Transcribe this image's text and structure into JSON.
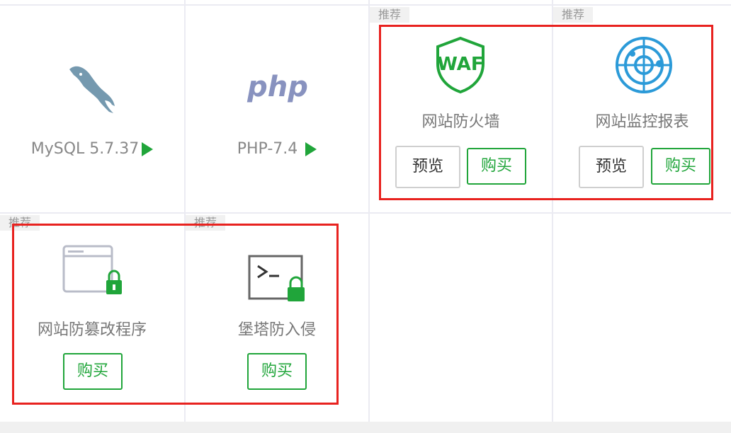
{
  "cards": {
    "mysql": {
      "name": "MySQL 5.7.37"
    },
    "php": {
      "name": "PHP-7.4",
      "logo_text": "php"
    },
    "waf": {
      "tag": "推荐",
      "logo_text": "WAF",
      "title": "网站防火墙",
      "preview_label": "预览",
      "buy_label": "购买"
    },
    "monitor": {
      "tag": "推荐",
      "title": "网站监控报表",
      "preview_label": "预览",
      "buy_label": "购买"
    },
    "tamper": {
      "tag": "推荐",
      "title": "网站防篡改程序",
      "buy_label": "购买"
    },
    "intrusion": {
      "tag": "推荐",
      "title": "堡塔防入侵",
      "buy_label": "购买"
    }
  },
  "icons": {
    "mysql": "mysql-dolphin-icon",
    "php": "php-logo-icon",
    "waf": "waf-shield-icon",
    "monitor": "monitor-radar-icon",
    "tamper": "browser-lock-icon",
    "intrusion": "terminal-lock-icon",
    "play": "play-triangle-icon"
  },
  "colors": {
    "accent_green": "#20a53a",
    "highlight_red": "#e8221f",
    "monitor_blue": "#2b9ad8",
    "php_blue": "#8892bf"
  }
}
